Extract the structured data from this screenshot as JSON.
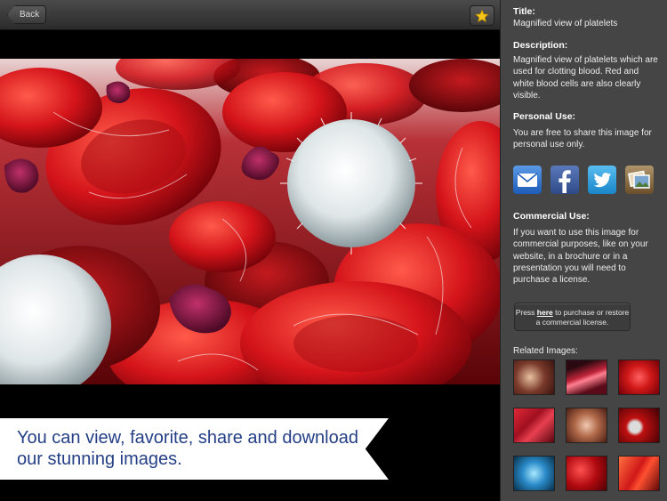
{
  "toolbar": {
    "back_label": "Back",
    "favorite_icon": "star-icon"
  },
  "caption": {
    "text": "You can view, favorite, share and download our stunning images."
  },
  "details": {
    "title_heading": "Title:",
    "title_value": "Magnified view of platelets",
    "description_heading": "Description:",
    "description_value": "Magnified view of platelets which are used for clotting blood. Red and white blood cells are also clearly visible.",
    "personal_heading": "Personal Use:",
    "personal_value": "You are free to share this image for personal use only.",
    "commercial_heading": "Commercial Use:",
    "commercial_value": "If you want to use this image for commercial purposes, like on your website, in a brochure or in a presentation you will need to purchase a license."
  },
  "share": {
    "icons": [
      "mail-icon",
      "facebook-icon",
      "twitter-icon",
      "photos-icon"
    ],
    "colors": {
      "mail": "#2a6fc9",
      "facebook": "#3b5b9d",
      "twitter": "#2d9fe0",
      "photos": "#8a6a3c"
    }
  },
  "license_button": {
    "prefix": "Press ",
    "link": "here",
    "suffix": " to purchase or restore a commercial license."
  },
  "related": {
    "heading": "Related Images:"
  },
  "colors": {
    "panel_bg": "#454545",
    "caption_text": "#243f86",
    "accent_star": "#f5c518"
  }
}
